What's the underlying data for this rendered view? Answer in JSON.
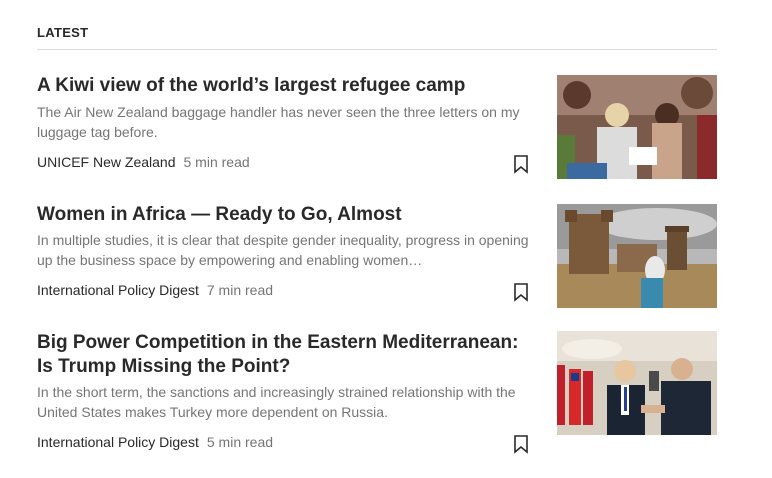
{
  "section": {
    "heading": "LATEST"
  },
  "articles": [
    {
      "title": "A Kiwi view of the world’s largest refugee camp",
      "subtitle": "The Air New Zealand baggage handler has never seen the three letters on my luggage tag before.",
      "publication": "UNICEF New Zealand",
      "read_time": "5 min read",
      "bookmark_icon": "bookmark-icon",
      "image_alt": "Children gathered around a woman reading"
    },
    {
      "title": "Women in Africa — Ready to Go, Almost",
      "subtitle": "In multiple studies, it is clear that despite gender inequality, progress in opening up the business space by empowering and enabling women…",
      "publication": "International Policy Digest",
      "read_time": "7 min read",
      "bookmark_icon": "bookmark-icon",
      "image_alt": "Woman in headscarf walking toward old stone castle"
    },
    {
      "title": "Big Power Competition in the Eastern Mediterranean: Is Trump Missing the Point?",
      "subtitle": "In the short term, the sanctions and increasingly strained relationship with the United States makes Turkey more dependent on Russia.",
      "publication": "International Policy Digest",
      "read_time": "5 min read",
      "bookmark_icon": "bookmark-icon",
      "image_alt": "Two leaders shaking hands in front of flags"
    }
  ],
  "colors": {
    "text_primary": "#292929",
    "text_secondary": "#757575",
    "divider": "#d9d9d9"
  }
}
